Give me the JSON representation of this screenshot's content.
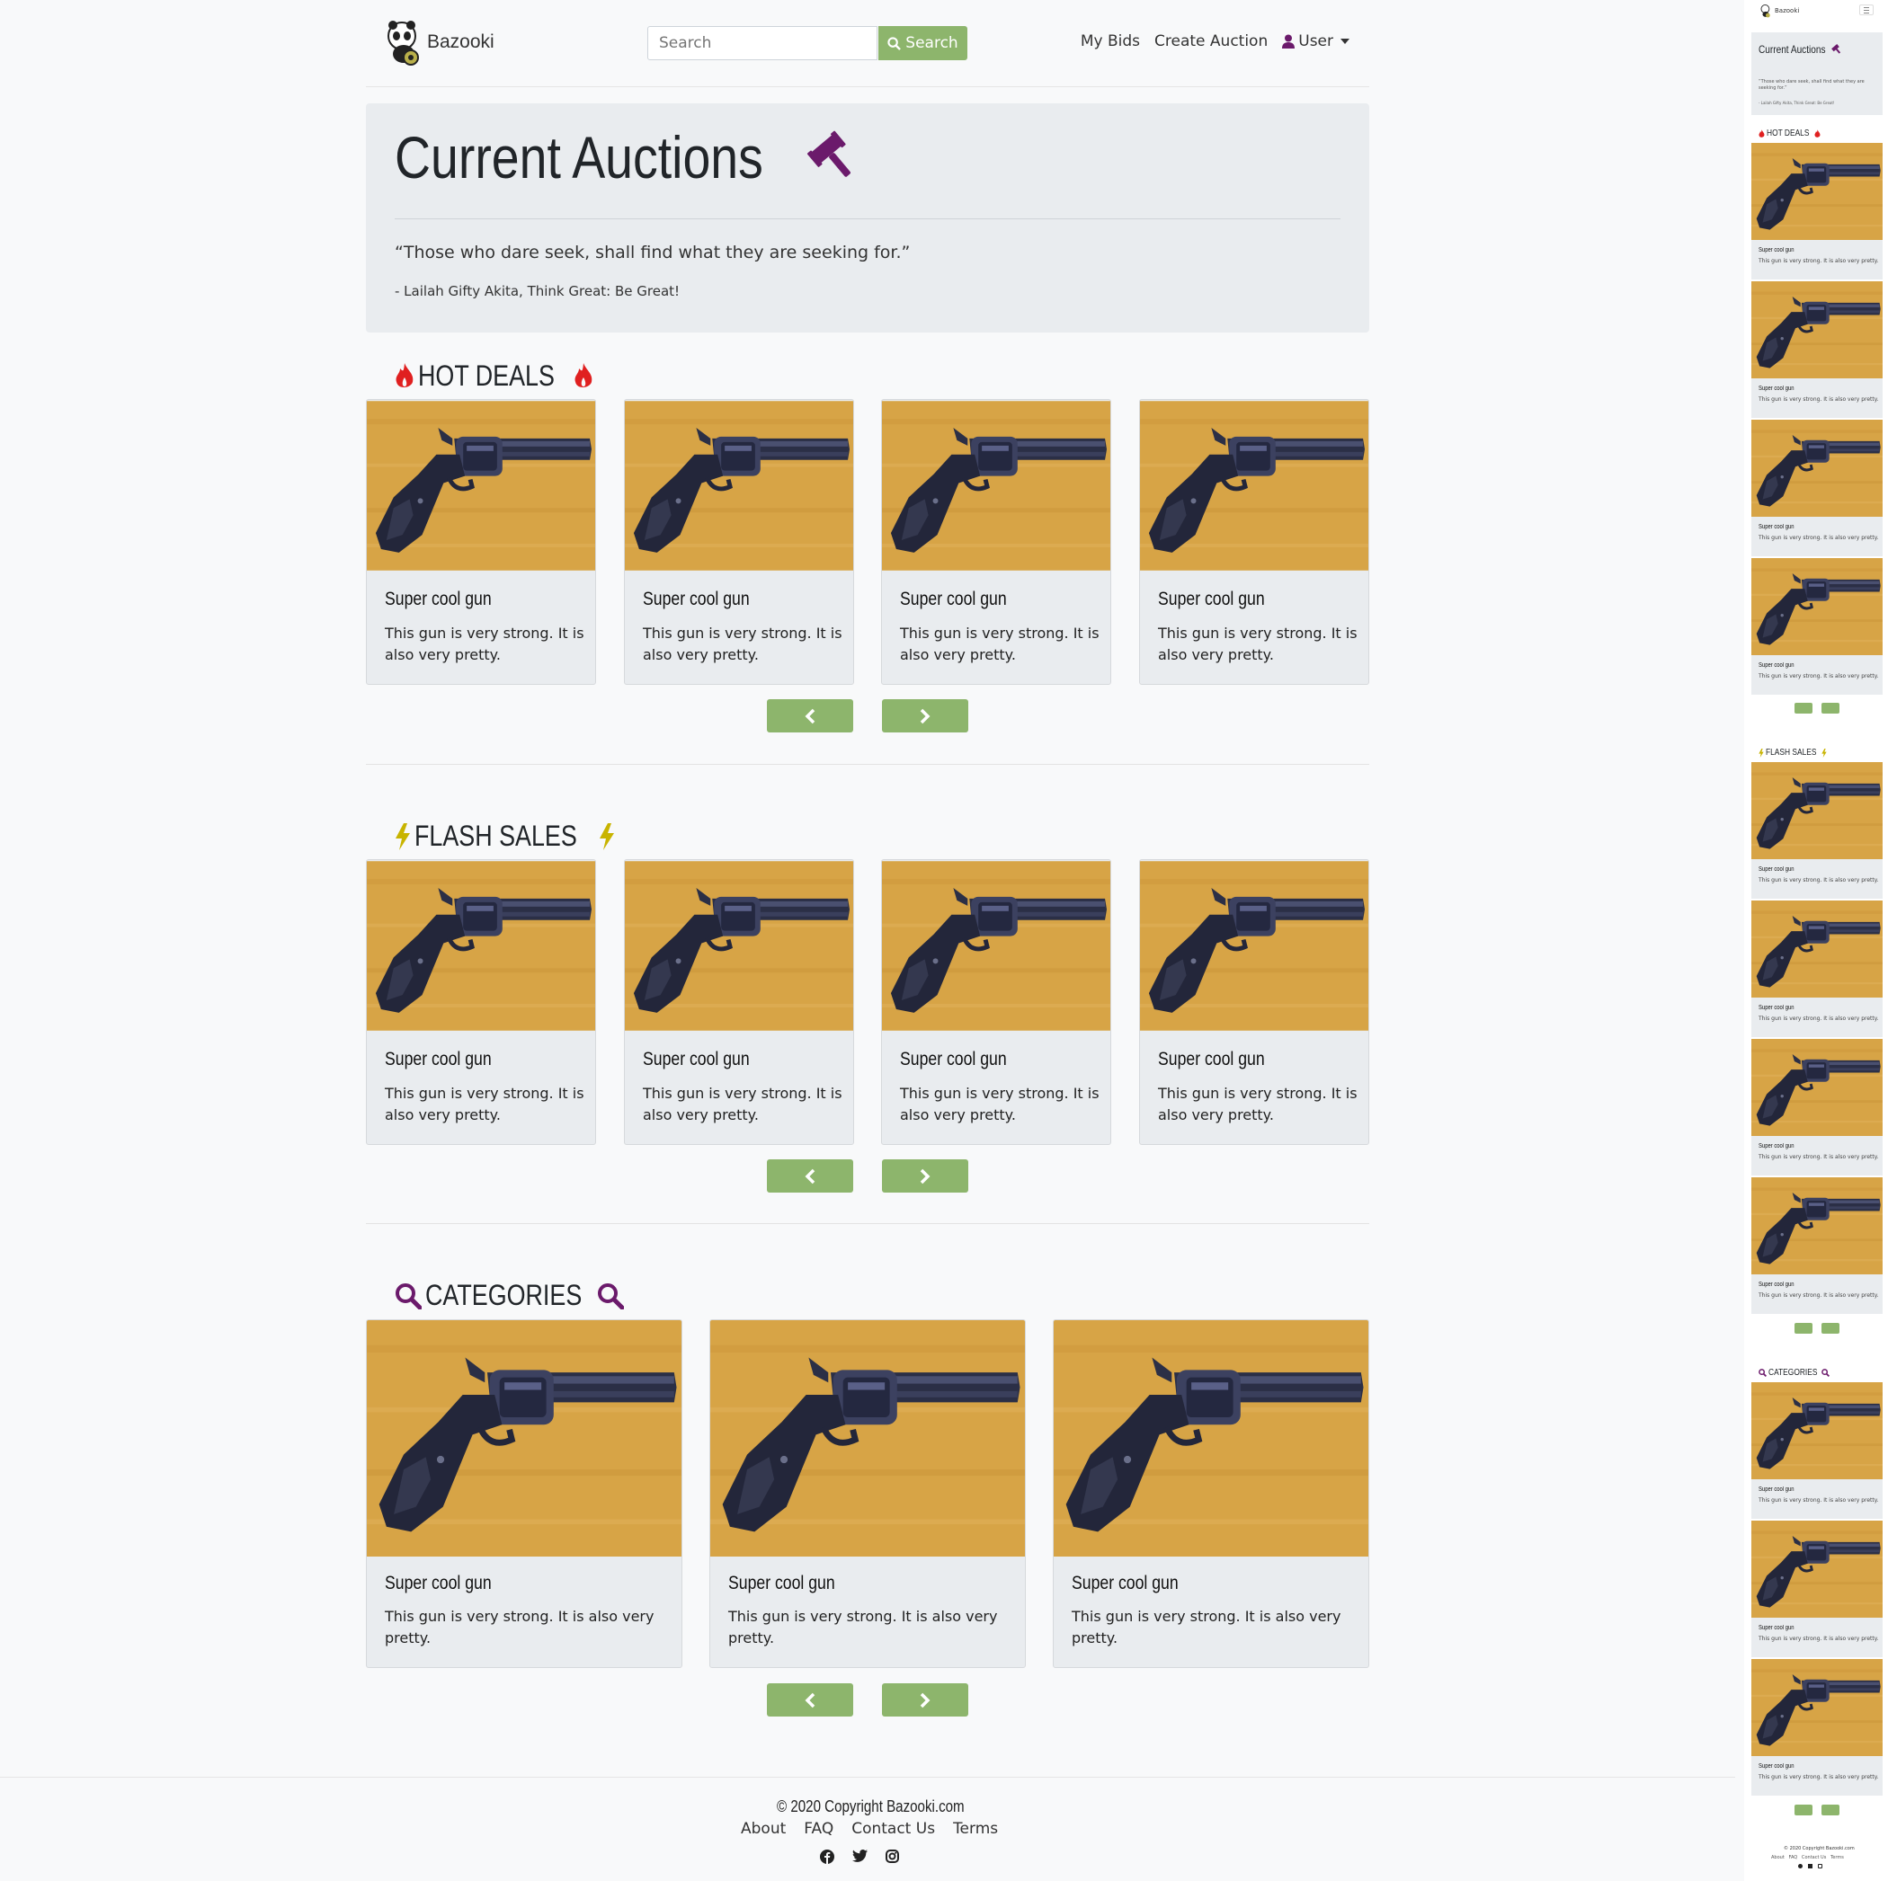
{
  "brand": {
    "name": "Bazooki"
  },
  "search": {
    "placeholder": "Search",
    "button_label": "Search"
  },
  "nav": {
    "my_bids": "My Bids",
    "create_auction": "Create Auction",
    "user": "User"
  },
  "hero": {
    "title": "Current Auctions",
    "quote": "“Those who dare seek, shall find what they are seeking for.”",
    "author": "- Lailah Gifty Akita, Think Great: Be Great!"
  },
  "sections": {
    "hot_deals": "HOT DEALS",
    "flash_sales": "FLASH SALES",
    "categories": "CATEGORIES"
  },
  "card": {
    "title": "Super cool gun",
    "text_line1": "This gun is very strong. It is",
    "text_line2": "also very pretty.",
    "wide_line1": "This gun is very strong. It is also very",
    "wide_line2": "pretty."
  },
  "footer": {
    "copyright": "© 2020 Copyright Bazooki.com",
    "links": [
      "About",
      "FAQ",
      "Contact Us",
      "Terms"
    ]
  },
  "side_preview": {
    "brand": "Bazooki",
    "title": "Current Auctions",
    "quote": "“Those who dare seek, shall find what they are seeking for.”",
    "author": "- Lailah Gifty Akita, Think Great: Be Great!",
    "card_title": "Super cool gun",
    "card_text": "This gun is very strong. It is also very pretty.",
    "copyright": "© 2020 Copyright Bazooki.com",
    "links": "About   FAQ   Contact Us   Terms"
  },
  "colors": {
    "accent_green": "#8db56c",
    "gavel_purple": "#6b1a6b",
    "fire_red": "#e02020",
    "bolt_yellow": "#c8b400",
    "search_purple": "#6b1a6b"
  },
  "icons": [
    "panda-logo-icon",
    "search-icon",
    "user-icon",
    "caret-down-icon",
    "gavel-icon",
    "fire-icon",
    "bolt-icon",
    "magnifier-icon",
    "chevron-left-icon",
    "chevron-right-icon",
    "facebook-icon",
    "twitter-icon",
    "instagram-icon"
  ]
}
